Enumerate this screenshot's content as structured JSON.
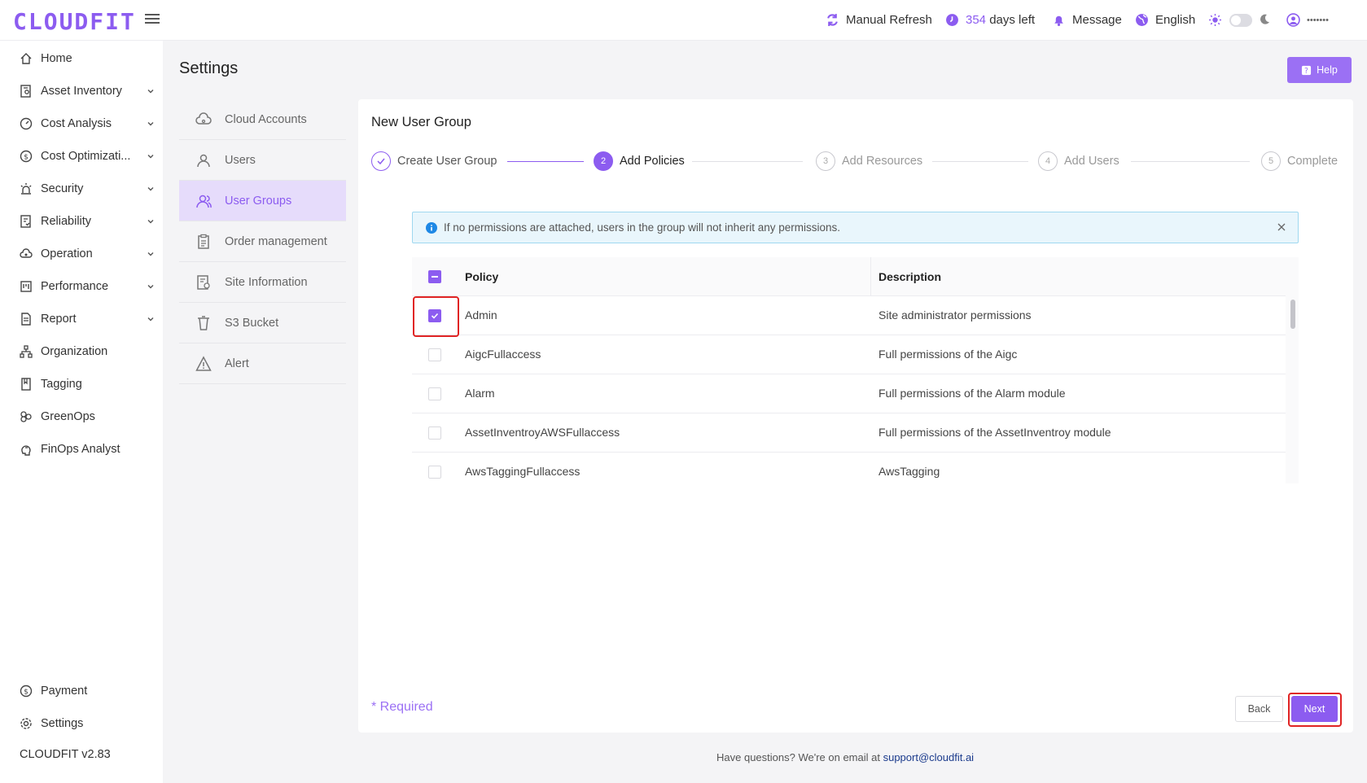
{
  "header": {
    "logo": "CLOUDFIT",
    "manual_refresh": "Manual Refresh",
    "days_count": "354",
    "days_left": "days left",
    "message": "Message",
    "language": "English",
    "username": "•••••••"
  },
  "sidebar": {
    "items": [
      {
        "label": "Home",
        "icon": "home-icon"
      },
      {
        "label": "Asset Inventory",
        "icon": "inventory-icon"
      },
      {
        "label": "Cost Analysis",
        "icon": "gauge-icon"
      },
      {
        "label": "Cost Optimizati...",
        "icon": "dollar-icon"
      },
      {
        "label": "Security",
        "icon": "alarm-light-icon"
      },
      {
        "label": "Reliability",
        "icon": "document-check-icon"
      },
      {
        "label": "Operation",
        "icon": "cloud-gear-icon"
      },
      {
        "label": "Performance",
        "icon": "board-icon"
      },
      {
        "label": "Report",
        "icon": "report-icon"
      },
      {
        "label": "Organization",
        "icon": "org-chart-icon"
      },
      {
        "label": "Tagging",
        "icon": "bookmark-icon"
      },
      {
        "label": "GreenOps",
        "icon": "leaf-icon"
      },
      {
        "label": "FinOps Analyst",
        "icon": "brain-icon"
      }
    ],
    "payment": "Payment",
    "settings": "Settings",
    "version": "CLOUDFIT v2.83"
  },
  "page": {
    "title": "Settings",
    "help": "Help"
  },
  "settings_menu": [
    "Cloud Accounts",
    "Users",
    "User Groups",
    "Order management",
    "Site Information",
    "S3 Bucket",
    "Alert"
  ],
  "card": {
    "title": "New User Group",
    "steps": [
      {
        "num": "",
        "label": "Create User Group",
        "state": "done"
      },
      {
        "num": "2",
        "label": "Add Policies",
        "state": "current"
      },
      {
        "num": "3",
        "label": "Add Resources",
        "state": "pending"
      },
      {
        "num": "4",
        "label": "Add Users",
        "state": "pending"
      },
      {
        "num": "5",
        "label": "Complete",
        "state": "pending"
      }
    ],
    "info": "If no permissions are attached, users in the group will not inherit any permissions.",
    "table": {
      "headers": {
        "policy": "Policy",
        "description": "Description"
      },
      "rows": [
        {
          "policy": "Admin",
          "description": "Site administrator permissions",
          "checked": true
        },
        {
          "policy": "AigcFullaccess",
          "description": "Full permissions of the Aigc",
          "checked": false
        },
        {
          "policy": "Alarm",
          "description": "Full permissions of the Alarm module",
          "checked": false
        },
        {
          "policy": "AssetInventroyAWSFullaccess",
          "description": "Full permissions of the AssetInventroy module",
          "checked": false
        },
        {
          "policy": "AwsTaggingFullaccess",
          "description": "AwsTagging",
          "checked": false
        }
      ]
    },
    "required": "* Required",
    "back": "Back",
    "next": "Next"
  },
  "footer": {
    "text": "Have questions? We're on email at",
    "email": "support@cloudfit.ai"
  },
  "colors": {
    "accent": "#8c5cf0",
    "highlight": "#e02424",
    "info_bg": "#e9f6fc"
  }
}
